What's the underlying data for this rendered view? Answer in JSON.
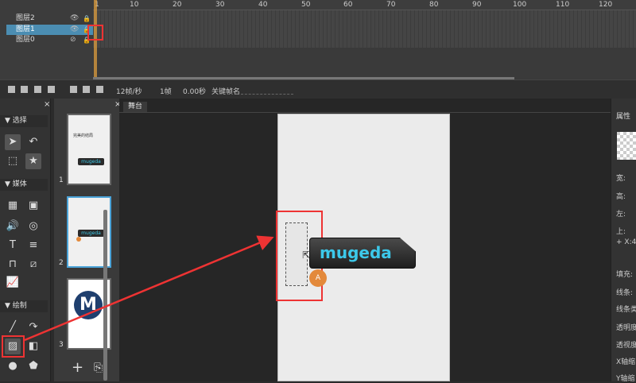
{
  "timeline": {
    "layers": [
      {
        "name": "图层2",
        "selected": false
      },
      {
        "name": "图层1",
        "selected": true
      },
      {
        "name": "图层0",
        "selected": false
      }
    ],
    "ruler_ticks": [
      "1",
      "10",
      "20",
      "30",
      "40",
      "50",
      "60",
      "70",
      "80",
      "90",
      "100",
      "110",
      "120"
    ]
  },
  "status_bar": {
    "fps": "12帧/秒",
    "frame": "1帧",
    "time": "0.00秒",
    "keyframe_name_label": "关键帧名"
  },
  "tool_panel": {
    "sections": {
      "select": "选择",
      "media": "媒体",
      "draw": "绘制"
    }
  },
  "pages_panel": {
    "page_numbers": [
      "1",
      "2",
      "3"
    ],
    "page1_heading": "完美的结局",
    "thumbnail_logo_text": "mugeda",
    "page3_logo_letter": "M",
    "add_label": "+"
  },
  "stage": {
    "tab_label": "舞台",
    "button_text": "mugeda",
    "badge_text": "A"
  },
  "properties": {
    "title": "属性",
    "labels": [
      "宽:",
      "高:",
      "左:",
      "上:",
      "+ X:4",
      "填充:",
      "线条:",
      "线条类",
      "透明度",
      "透视度",
      "X轴缩",
      "Y轴缩"
    ]
  },
  "colors": {
    "highlight": "#e33333",
    "accent": "#3cc8ea",
    "badge": "#e3893a"
  }
}
